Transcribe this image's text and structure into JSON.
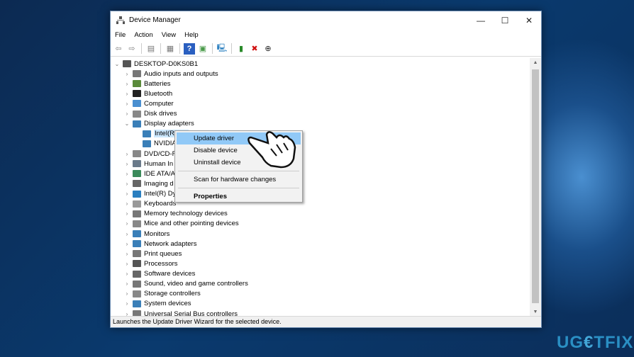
{
  "window": {
    "title": "Device Manager",
    "minimize": "—",
    "maximize": "☐",
    "close": "✕"
  },
  "menu": [
    "File",
    "Action",
    "View",
    "Help"
  ],
  "toolbar": [
    {
      "icon": "back-arrow-icon",
      "glyph": "⇦",
      "color": "#888"
    },
    {
      "icon": "forward-arrow-icon",
      "glyph": "⇨",
      "color": "#888"
    },
    {
      "icon": "sep"
    },
    {
      "icon": "properties-icon",
      "glyph": "▤",
      "color": "#777"
    },
    {
      "icon": "sep"
    },
    {
      "icon": "show-hidden-icon",
      "glyph": "▦",
      "color": "#777"
    },
    {
      "icon": "sep"
    },
    {
      "icon": "help-icon",
      "glyph": "?",
      "color": "#fff",
      "bg": "#2a5fc0"
    },
    {
      "icon": "action-pane-icon",
      "glyph": "▣",
      "color": "#4a9a4a"
    },
    {
      "icon": "sep"
    },
    {
      "icon": "scan-hardware-icon",
      "glyph": "🖳",
      "color": "#2a7fc0"
    },
    {
      "icon": "sep"
    },
    {
      "icon": "add-driver-icon",
      "glyph": "▮",
      "color": "#2a8a2a"
    },
    {
      "icon": "uninstall-x-icon",
      "glyph": "✖",
      "color": "#d01010"
    },
    {
      "icon": "download-driver-icon",
      "glyph": "⊕",
      "color": "#222"
    }
  ],
  "tree": [
    {
      "label": "DESKTOP-D0KS0B1",
      "level": 0,
      "state": "open",
      "color": "#555"
    },
    {
      "label": "Audio inputs and outputs",
      "level": 1,
      "state": "closed",
      "color": "#777"
    },
    {
      "label": "Batteries",
      "level": 1,
      "state": "closed",
      "color": "#5a8a3a"
    },
    {
      "label": "Bluetooth",
      "level": 1,
      "state": "closed",
      "color": "#222"
    },
    {
      "label": "Computer",
      "level": 1,
      "state": "closed",
      "color": "#4a8fd0"
    },
    {
      "label": "Disk drives",
      "level": 1,
      "state": "closed",
      "color": "#888"
    },
    {
      "label": "Display adapters",
      "level": 1,
      "state": "open",
      "color": "#3a7fb8"
    },
    {
      "label": "Intel(R",
      "level": 2,
      "state": "none",
      "color": "#3a7fb8",
      "selected": true
    },
    {
      "label": "NVIDIA",
      "level": 2,
      "state": "none",
      "color": "#3a7fb8"
    },
    {
      "label": "DVD/CD-R",
      "level": 1,
      "state": "closed",
      "color": "#888"
    },
    {
      "label": "Human In",
      "level": 1,
      "state": "closed",
      "color": "#6a7a8a"
    },
    {
      "label": "IDE ATA/A",
      "level": 1,
      "state": "closed",
      "color": "#3a8a5a"
    },
    {
      "label": "Imaging d",
      "level": 1,
      "state": "closed",
      "color": "#666"
    },
    {
      "label": "Intel(R) Dy",
      "level": 1,
      "state": "closed",
      "color": "#2a7fc0"
    },
    {
      "label": "Keyboards",
      "level": 1,
      "state": "closed",
      "color": "#999"
    },
    {
      "label": "Memory technology devices",
      "level": 1,
      "state": "closed",
      "color": "#777"
    },
    {
      "label": "Mice and other pointing devices",
      "level": 1,
      "state": "closed",
      "color": "#888"
    },
    {
      "label": "Monitors",
      "level": 1,
      "state": "closed",
      "color": "#3a7fb8"
    },
    {
      "label": "Network adapters",
      "level": 1,
      "state": "closed",
      "color": "#3a7fb8"
    },
    {
      "label": "Print queues",
      "level": 1,
      "state": "closed",
      "color": "#777"
    },
    {
      "label": "Processors",
      "level": 1,
      "state": "closed",
      "color": "#555"
    },
    {
      "label": "Software devices",
      "level": 1,
      "state": "closed",
      "color": "#666"
    },
    {
      "label": "Sound, video and game controllers",
      "level": 1,
      "state": "closed",
      "color": "#777"
    },
    {
      "label": "Storage controllers",
      "level": 1,
      "state": "closed",
      "color": "#888"
    },
    {
      "label": "System devices",
      "level": 1,
      "state": "closed",
      "color": "#3a7fb8"
    },
    {
      "label": "Universal Serial Bus controllers",
      "level": 1,
      "state": "closed",
      "color": "#777"
    }
  ],
  "context_menu": {
    "items": [
      "Update driver",
      "Disable device",
      "Uninstall device",
      "Scan for hardware changes",
      "Properties"
    ],
    "highlight": "#91c9f7"
  },
  "status": "Launches the Update Driver Wizard for the selected device.",
  "watermark": {
    "text": "UG€TFIX"
  }
}
